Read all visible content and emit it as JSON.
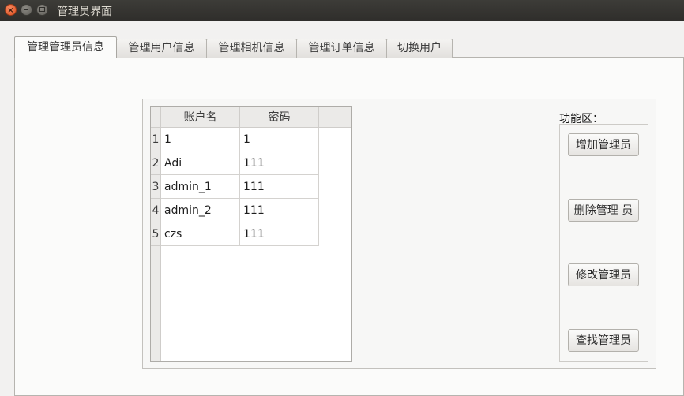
{
  "window": {
    "title": "管理员界面",
    "controls": {
      "close": "×",
      "minimize": "",
      "maximize": ""
    }
  },
  "tabs": [
    {
      "label": "管理管理员信息",
      "active": true
    },
    {
      "label": "管理用户信息",
      "active": false
    },
    {
      "label": "管理相机信息",
      "active": false
    },
    {
      "label": "管理订单信息",
      "active": false
    },
    {
      "label": "切换用户",
      "active": false
    }
  ],
  "table": {
    "columns": [
      "账户名",
      "密码"
    ],
    "rows": [
      {
        "num": "1",
        "account": "1",
        "password": "1"
      },
      {
        "num": "2",
        "account": "Adi",
        "password": "111"
      },
      {
        "num": "3",
        "account": "admin_1",
        "password": "111"
      },
      {
        "num": "4",
        "account": "admin_2",
        "password": "111"
      },
      {
        "num": "5",
        "account": "czs",
        "password": "111"
      }
    ]
  },
  "functions": {
    "label": "功能区：",
    "buttons": [
      "增加管理员",
      "删除管理 员",
      "修改管理员",
      "查找管理员"
    ]
  },
  "colors": {
    "titlebar": "#3d3c38",
    "close_button": "#e9602f",
    "window_bg": "#f2f1f0"
  }
}
